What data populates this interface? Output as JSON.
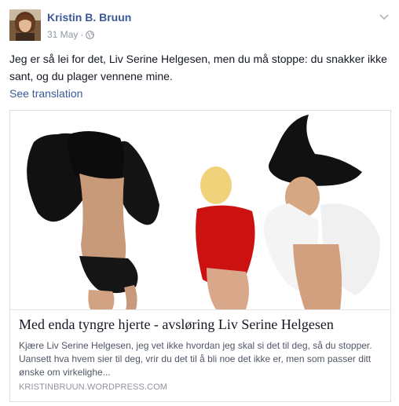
{
  "post": {
    "author": "Kristin B. Bruun",
    "date": "31 May",
    "separator": "·",
    "privacy_icon": "globe-icon",
    "menu_icon": "chevron-down-icon",
    "text": "Jeg er så lei for det, Liv Serine Helgesen, men du må stoppe: du snakker ikke sant, og du plager vennene mine.",
    "see_translation": "See translation"
  },
  "link_card": {
    "title": "Med enda tyngre hjerte - avsløring Liv Serine Helgesen",
    "description": "Kjære Liv Serine Helgesen, jeg vet ikke hvordan jeg skal si det til deg, så du stopper. Uansett hva hvem sier til deg, vrir du det til å bli noe det ikke er, men som passer ditt ønske om virkelighe...",
    "domain": "KRISTINBRUUN.WORDPRESS.COM"
  },
  "colors": {
    "link_blue": "#3b5998",
    "meta_gray": "#9197a3",
    "body_text": "#141823"
  }
}
